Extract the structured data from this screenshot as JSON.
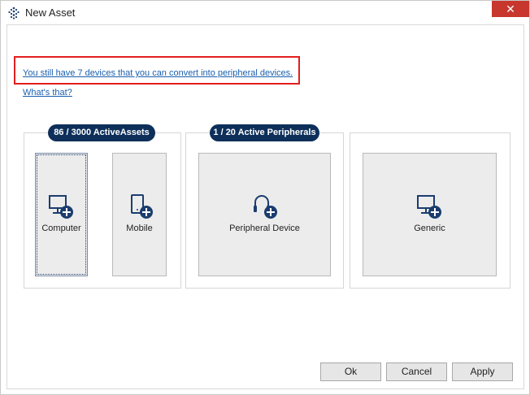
{
  "window": {
    "title": "New Asset",
    "close_glyph": "✕"
  },
  "links": {
    "convert": "You still have 7 devices that you can convert into peripheral devices.",
    "whats_that": "What's that?"
  },
  "groups": {
    "active_assets": {
      "badge": "86 / 3000 ActiveAssets",
      "tiles": [
        {
          "label": "Computer",
          "icon": "computer-add-icon"
        },
        {
          "label": "Mobile",
          "icon": "mobile-add-icon"
        }
      ]
    },
    "active_peripherals": {
      "badge": "1 / 20 Active Peripherals",
      "tiles": [
        {
          "label": "Peripheral Device",
          "icon": "headset-add-icon"
        }
      ]
    },
    "generic": {
      "tiles": [
        {
          "label": "Generic",
          "icon": "generic-add-icon"
        }
      ]
    }
  },
  "buttons": {
    "ok": "Ok",
    "cancel": "Cancel",
    "apply": "Apply"
  },
  "colors": {
    "badge": "#0d2f5a",
    "link": "#1a5fae",
    "highlight": "#e31e1e",
    "close": "#c7372e",
    "icon": "#1b3d6e"
  }
}
